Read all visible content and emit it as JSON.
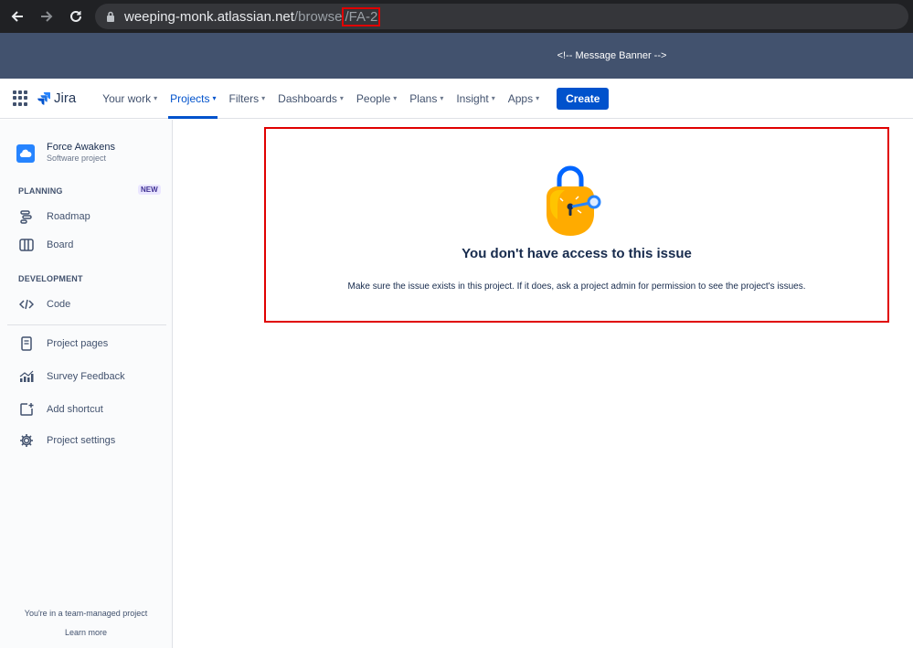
{
  "browser": {
    "url_host": "weeping-monk.atlassian.net",
    "url_path": "/browse",
    "url_issue": "/FA-2"
  },
  "banner": {
    "text": "<!-- Message Banner -->"
  },
  "topnav": {
    "logo": "Jira",
    "items": [
      {
        "label": "Your work",
        "active": false
      },
      {
        "label": "Projects",
        "active": true
      },
      {
        "label": "Filters",
        "active": false
      },
      {
        "label": "Dashboards",
        "active": false
      },
      {
        "label": "People",
        "active": false
      },
      {
        "label": "Plans",
        "active": false
      },
      {
        "label": "Insight",
        "active": false
      },
      {
        "label": "Apps",
        "active": false
      }
    ],
    "create_label": "Create"
  },
  "sidebar": {
    "project_name": "Force Awakens",
    "project_type": "Software project",
    "planning_label": "PLANNING",
    "new_badge": "NEW",
    "roadmap": "Roadmap",
    "board": "Board",
    "development_label": "DEVELOPMENT",
    "code": "Code",
    "project_pages": "Project pages",
    "survey_feedback": "Survey Feedback",
    "add_shortcut": "Add shortcut",
    "project_settings": "Project settings",
    "footer_text": "You're in a team-managed project",
    "learn_more": "Learn more"
  },
  "main": {
    "error_title": "You don't have access to this issue",
    "error_description": "Make sure the issue exists in this project. If it does, ask a project admin for permission to see the project's issues."
  },
  "colors": {
    "accent": "#0052cc",
    "banner": "#42526e",
    "highlight": "#e00000"
  }
}
